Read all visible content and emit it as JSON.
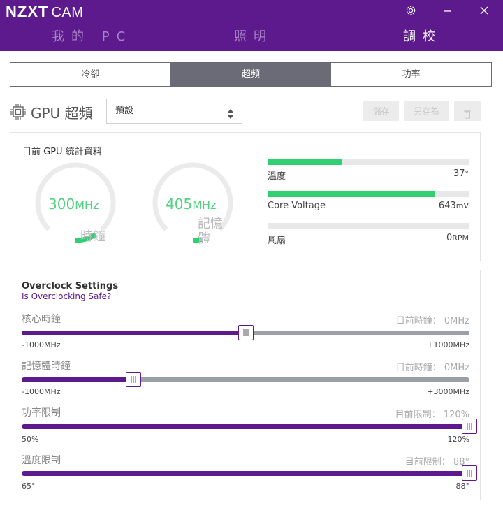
{
  "header": {
    "brand_bold": "NZXT",
    "brand_light": "CAM",
    "nav": [
      {
        "label": "我的 PC",
        "active": false
      },
      {
        "label": "照明",
        "active": false
      },
      {
        "label": "調校",
        "active": true
      }
    ]
  },
  "tabs": [
    {
      "label": "冷卻",
      "active": false
    },
    {
      "label": "超頻",
      "active": true
    },
    {
      "label": "功率",
      "active": false
    }
  ],
  "title_row": {
    "title": "GPU 超頻",
    "preset": "預設",
    "save_label": "儲存",
    "save_as_label": "另存為"
  },
  "stats": {
    "title": "目前 GPU 統計資料",
    "clock": {
      "value": "300",
      "unit": "MHz",
      "label": "時鐘",
      "fraction": 0.12
    },
    "memory": {
      "value": "405",
      "unit": "MHz",
      "label_line1": "記憶",
      "label_line2": "體",
      "fraction": 0.05
    },
    "bars": [
      {
        "label": "溫度",
        "value": "37",
        "unit": "°",
        "fraction": 0.37
      },
      {
        "label": "Core Voltage",
        "value": "643",
        "unit": "mV",
        "fraction": 0.83
      },
      {
        "label": "風扇",
        "value": "0",
        "unit": "RPM",
        "fraction": 0.0
      }
    ]
  },
  "overclock": {
    "title": "Overclock Settings",
    "link": "Is Overclocking Safe?",
    "sliders": [
      {
        "label": "核心時鐘",
        "current_label": "目前時鐘：",
        "current_value": "0",
        "current_unit": "MHz",
        "min": "-1000MHz",
        "max": "+1000MHz",
        "fraction": 0.5
      },
      {
        "label": "記憶體時鐘",
        "current_label": "目前時鐘：",
        "current_value": "0",
        "current_unit": "MHz",
        "min": "-1000MHz",
        "max": "+3000MHz",
        "fraction": 0.25
      },
      {
        "label": "功率限制",
        "current_label": "目前限制：",
        "current_value": "120",
        "current_unit": "%",
        "min": "50%",
        "max": "120%",
        "fraction": 1.0
      },
      {
        "label": "溫度限制",
        "current_label": "目前限制：",
        "current_value": "88",
        "current_unit": "°",
        "min": "65°",
        "max": "88°",
        "fraction": 1.0
      }
    ]
  },
  "colors": {
    "brand": "#5c1a8c",
    "accent_green": "#2fcf72"
  }
}
